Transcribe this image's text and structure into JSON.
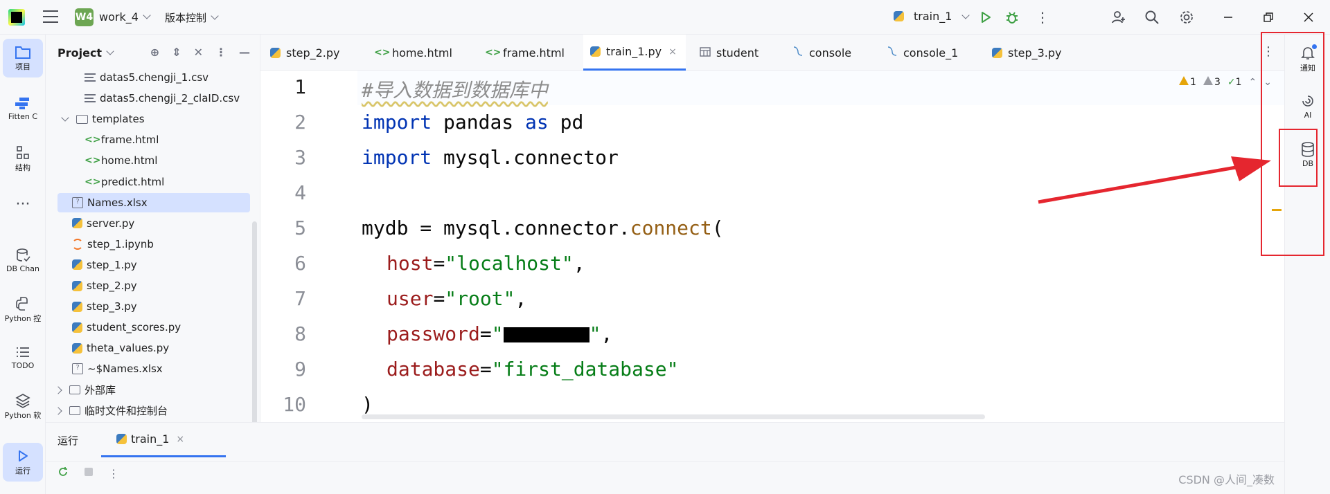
{
  "titlebar": {
    "project_badge": "W4",
    "project_name": "work_4",
    "vcs_label": "版本控制",
    "run_config": "train_1"
  },
  "left_toolbar": [
    {
      "label": "项目",
      "icon": "folder-icon",
      "active": true
    },
    {
      "label": "Fitten C",
      "icon": "fitten-code-icon"
    },
    {
      "label": "结构",
      "icon": "structure-icon"
    },
    {
      "label": "",
      "icon": "more-icon"
    },
    {
      "label": "DB Chan",
      "icon": "db-chan-icon"
    },
    {
      "label": "Python 控",
      "icon": "python-console-icon"
    },
    {
      "label": "TODO",
      "icon": "todo-icon"
    },
    {
      "label": "Python 软",
      "icon": "python-packages-icon"
    },
    {
      "label": "运行",
      "icon": "run-icon",
      "active": true
    }
  ],
  "project_panel": {
    "title": "Project",
    "tree": [
      {
        "label": "datas5.chengji_1.csv",
        "type": "txt",
        "indent": 2
      },
      {
        "label": "datas5.chengji_2_claID.csv",
        "type": "txt",
        "indent": 2
      },
      {
        "label": "templates",
        "type": "folder",
        "indent": 1,
        "expanded": true
      },
      {
        "label": "frame.html",
        "type": "html",
        "indent": 2
      },
      {
        "label": "home.html",
        "type": "html",
        "indent": 2
      },
      {
        "label": "predict.html",
        "type": "html",
        "indent": 2
      },
      {
        "label": "Names.xlsx",
        "type": "unknown",
        "indent": 1,
        "selected": true
      },
      {
        "label": "server.py",
        "type": "py",
        "indent": 1
      },
      {
        "label": "step_1.ipynb",
        "type": "jup",
        "indent": 1
      },
      {
        "label": "step_1.py",
        "type": "py",
        "indent": 1
      },
      {
        "label": "step_2.py",
        "type": "py",
        "indent": 1
      },
      {
        "label": "step_3.py",
        "type": "py",
        "indent": 1
      },
      {
        "label": "student_scores.py",
        "type": "py",
        "indent": 1
      },
      {
        "label": "theta_values.py",
        "type": "py",
        "indent": 1
      },
      {
        "label": "~$Names.xlsx",
        "type": "unknown",
        "indent": 1
      },
      {
        "label": "外部库",
        "type": "lib",
        "indent": 0,
        "collapsed": true
      },
      {
        "label": "临时文件和控制台",
        "type": "lib",
        "indent": 0,
        "collapsed": true
      }
    ]
  },
  "tabs": [
    {
      "label": "step_2.py",
      "icon": "python-file-icon"
    },
    {
      "label": "home.html",
      "icon": "html-file-icon"
    },
    {
      "label": "frame.html",
      "icon": "html-file-icon"
    },
    {
      "label": "train_1.py",
      "icon": "python-file-icon",
      "active": true,
      "close": "×"
    },
    {
      "label": "student",
      "icon": "table-icon"
    },
    {
      "label": "console",
      "icon": "console-icon"
    },
    {
      "label": "console_1",
      "icon": "console-icon"
    },
    {
      "label": "step_3.py",
      "icon": "python-file-icon"
    }
  ],
  "editor": {
    "line_numbers": [
      "1",
      "2",
      "3",
      "4",
      "5",
      "6",
      "7",
      "8",
      "9",
      "10"
    ],
    "inspections": {
      "warnings": "1",
      "weak_warnings": "3",
      "ok": "1"
    },
    "code": {
      "l1": "#导入数据到数据库中",
      "l2_kw": "import",
      "l2_rest": " pandas ",
      "l2_as": "as",
      "l2_alias": " pd",
      "l3_kw": "import",
      "l3_rest": " mysql.connector",
      "l5_a": "mydb = mysql.connector.",
      "l5_fn": "connect",
      "l5_b": "(",
      "l6_p": "host",
      "l6_eq": "=",
      "l6_s": "\"localhost\"",
      "l6_c": ",",
      "l7_p": "user",
      "l7_eq": "=",
      "l7_s": "\"root\"",
      "l7_c": ",",
      "l8_p": "password",
      "l8_eq": "=",
      "l8_q1": "\"",
      "l8_q2": "\"",
      "l8_c": ",",
      "l9_p": "database",
      "l9_eq": "=",
      "l9_s": "\"first_database\"",
      "l10": ")"
    }
  },
  "right_toolbar": [
    {
      "label": "通知",
      "icon": "bell-icon"
    },
    {
      "label": "AI",
      "icon": "ai-icon"
    },
    {
      "label": "DB",
      "icon": "database-icon"
    }
  ],
  "bottom_panel": {
    "title": "运行",
    "tab": "train_1",
    "tab_close": "×"
  },
  "watermark": "CSDN @人间_凑数",
  "colors": {
    "accent": "#3574f0",
    "annotation": "#e5262f"
  }
}
